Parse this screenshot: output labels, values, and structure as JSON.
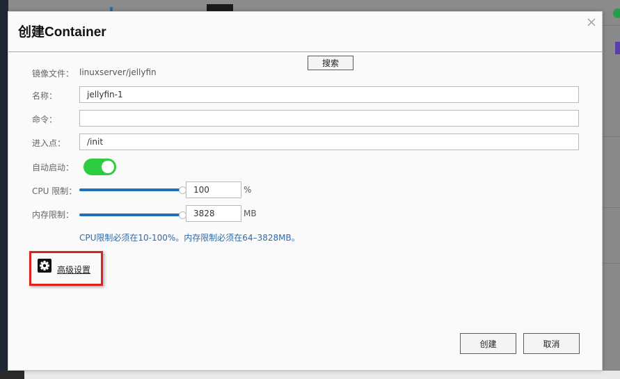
{
  "dialog": {
    "title": "创建Container",
    "search_button": "搜索",
    "image_label": "镜像文件：",
    "image_value": "linuxserver/jellyfin",
    "name_label": "名称：",
    "name_value": "jellyfin-1",
    "command_label": "命令：",
    "command_value": "",
    "entrypoint_label": "进入点：",
    "entrypoint_value": "/init",
    "autostart_label": "自动启动：",
    "autostart_on": true,
    "cpu_label": "CPU 限制：",
    "cpu_value": "100",
    "cpu_unit": "%",
    "cpu_slider_fraction": 1.0,
    "mem_label": "内存限制：",
    "mem_value": "3828",
    "mem_unit": "MB",
    "mem_slider_fraction": 1.0,
    "hint": "CPU限制必须在10-100%。内存限制必须在64–3828MB。",
    "advanced_link": "高级设置",
    "create_button": "创建",
    "cancel_button": "取消"
  },
  "colors": {
    "accent": "#1f6fba",
    "toggle_on": "#2ecc40",
    "highlight_box": "#e21f1f",
    "hint_text": "#2e6aa6"
  }
}
